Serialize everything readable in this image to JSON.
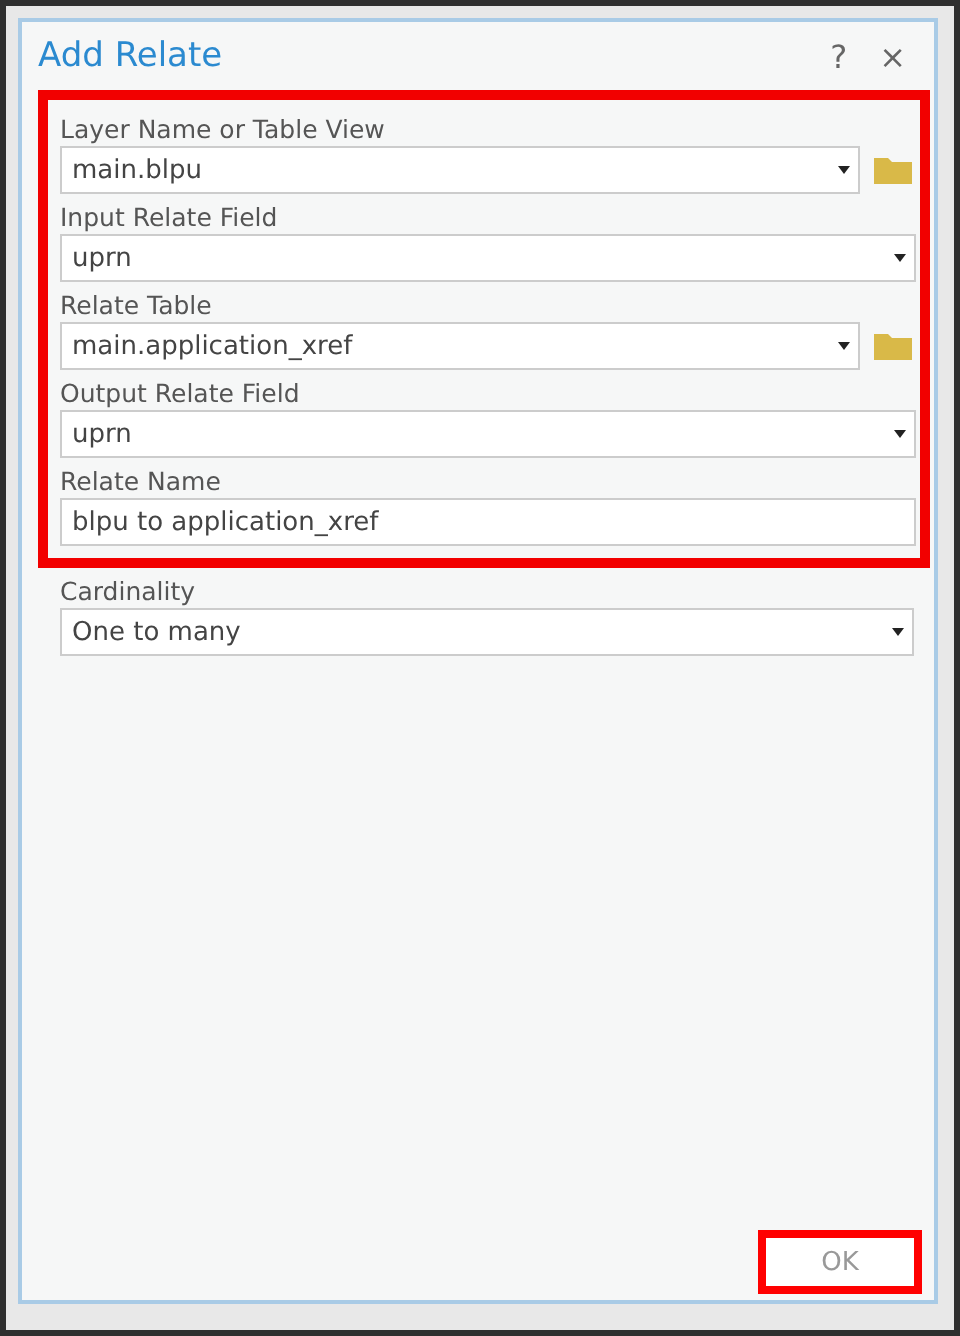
{
  "window": {
    "title": "Add Relate",
    "help": "?",
    "close": "×"
  },
  "highlighted_fields": [
    {
      "label": "Layer Name or Table View",
      "value": "main.blpu",
      "kind": "dropdown",
      "browse": true
    },
    {
      "label": "Input Relate Field",
      "value": "uprn",
      "kind": "dropdown",
      "browse": false
    },
    {
      "label": "Relate Table",
      "value": "main.application_xref",
      "kind": "dropdown",
      "browse": true
    },
    {
      "label": "Output Relate Field",
      "value": "uprn",
      "kind": "dropdown",
      "browse": false
    },
    {
      "label": "Relate Name",
      "value": "blpu to application_xref",
      "kind": "text",
      "browse": false
    }
  ],
  "fields": [
    {
      "label": "Cardinality",
      "value": "One to many",
      "kind": "dropdown",
      "browse": false
    }
  ],
  "buttons": [
    {
      "label": "OK",
      "disabled": true,
      "highlighted": true
    }
  ]
}
